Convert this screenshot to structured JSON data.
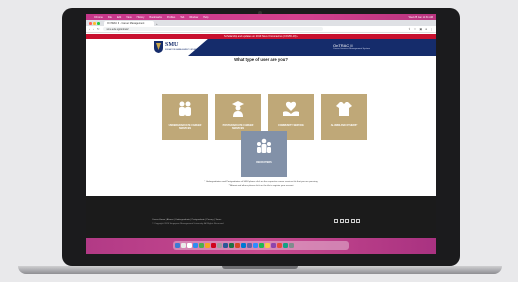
{
  "menubar": {
    "items": [
      "Chrome",
      "File",
      "Edit",
      "View",
      "History",
      "Bookmarks",
      "Profiles",
      "Tab",
      "Window",
      "Help"
    ],
    "clock": "Wed 25 Jan 11:31 AM"
  },
  "browser": {
    "tab_title": "OnTRAC II - Career Management",
    "new_tab": "+",
    "url": "smu.edu.sg/ontrac2"
  },
  "announcement": "Scholarship and updates on 2019 Novel Coronavirus (COVID-19) ›",
  "header": {
    "logo_text": "SMU",
    "logo_sub": "SINGAPORE MANAGEMENT UNIVERSITY",
    "app_name": "OnTRAC II",
    "app_sub": "Career Services Management System"
  },
  "question": "What type of user are you?",
  "user_types": [
    {
      "label": "UNDERGRADUATE CAREER SERVICES",
      "icon": "students-icon"
    },
    {
      "label": "POSTGRADUATE CAREER SERVICES",
      "icon": "graduate-icon"
    },
    {
      "label": "COMMUNITY SERVICE",
      "icon": "helping-hands-icon"
    },
    {
      "label": "ALUMNI AND OTHERS*",
      "icon": "shirt-icon"
    },
    {
      "label": "RECRUITERS",
      "icon": "group-icon"
    }
  ],
  "note": {
    "line1": "* Undergraduates and Postgraduates of SMU please click on the respective career services tile that you are pursuing",
    "line2": "**Alumni and others please click on the tile to register your account"
  },
  "footer": {
    "links": "Career Home | Alumni | Undergraduate | Postgraduate | Privacy | Terms",
    "copyright": "© Copyright 2020 Singapore Management University. All Rights Reserved."
  },
  "colors": {
    "tile_gold": "#bfa878",
    "tile_grey": "#8291a8",
    "navy": "#152c6b",
    "announce_red": "#c8102e"
  }
}
